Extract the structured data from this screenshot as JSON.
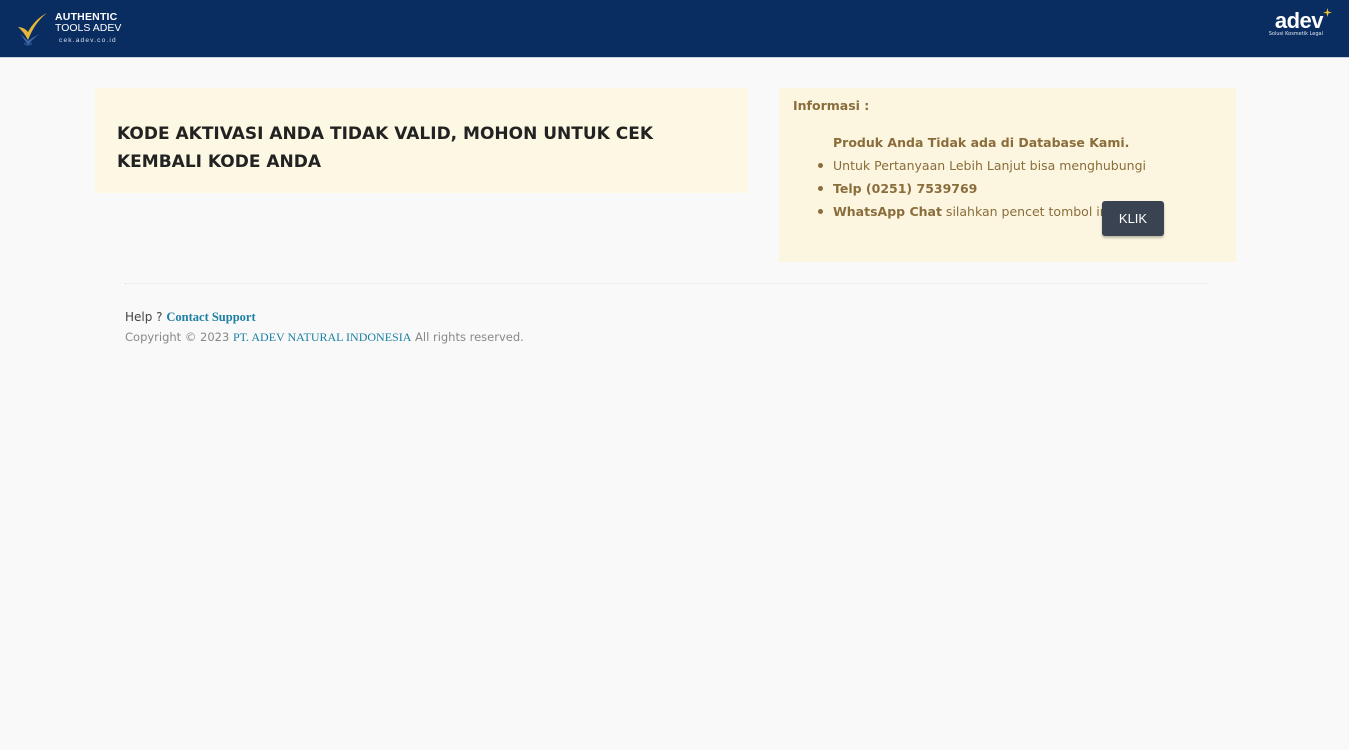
{
  "header": {
    "logo_left": {
      "line1": "AUTHENTIC",
      "line2": "TOOLS ADEV",
      "line3": "cek.adev.co.id",
      "icon": "check-badge-icon"
    },
    "logo_right": {
      "word": "adev",
      "tagline": "Solusi Kosmetik Legal",
      "icon": "sparkle-icon"
    },
    "background": "#0a2d61"
  },
  "alert": {
    "message": "KODE AKTIVASI ANDA TIDAK VALID, MOHON UNTUK CEK KEMBALI KODE ANDA",
    "background": "#fcf8e3"
  },
  "info": {
    "heading": "Informasi :",
    "subheading": "Produk Anda Tidak ada di Database Kami.",
    "items": [
      {
        "text": "Untuk Pertanyaan Lebih Lanjut bisa menghubungi"
      },
      {
        "bold": "Telp (0251) 7539769"
      },
      {
        "bold": "WhatsApp Chat",
        "text": " silahkan pencet tombol ini :"
      }
    ],
    "button_label": "KLIK",
    "text_color": "#8a6d3b"
  },
  "footer": {
    "help_prefix": "Help ?",
    "help_link": "Contact Support",
    "copyright_prefix": "Copyright © 2023",
    "company_link": "PT. ADEV NATURAL INDONESIA",
    "copyright_suffix": "All rights reserved.",
    "link_color": "#1c7fa4"
  }
}
